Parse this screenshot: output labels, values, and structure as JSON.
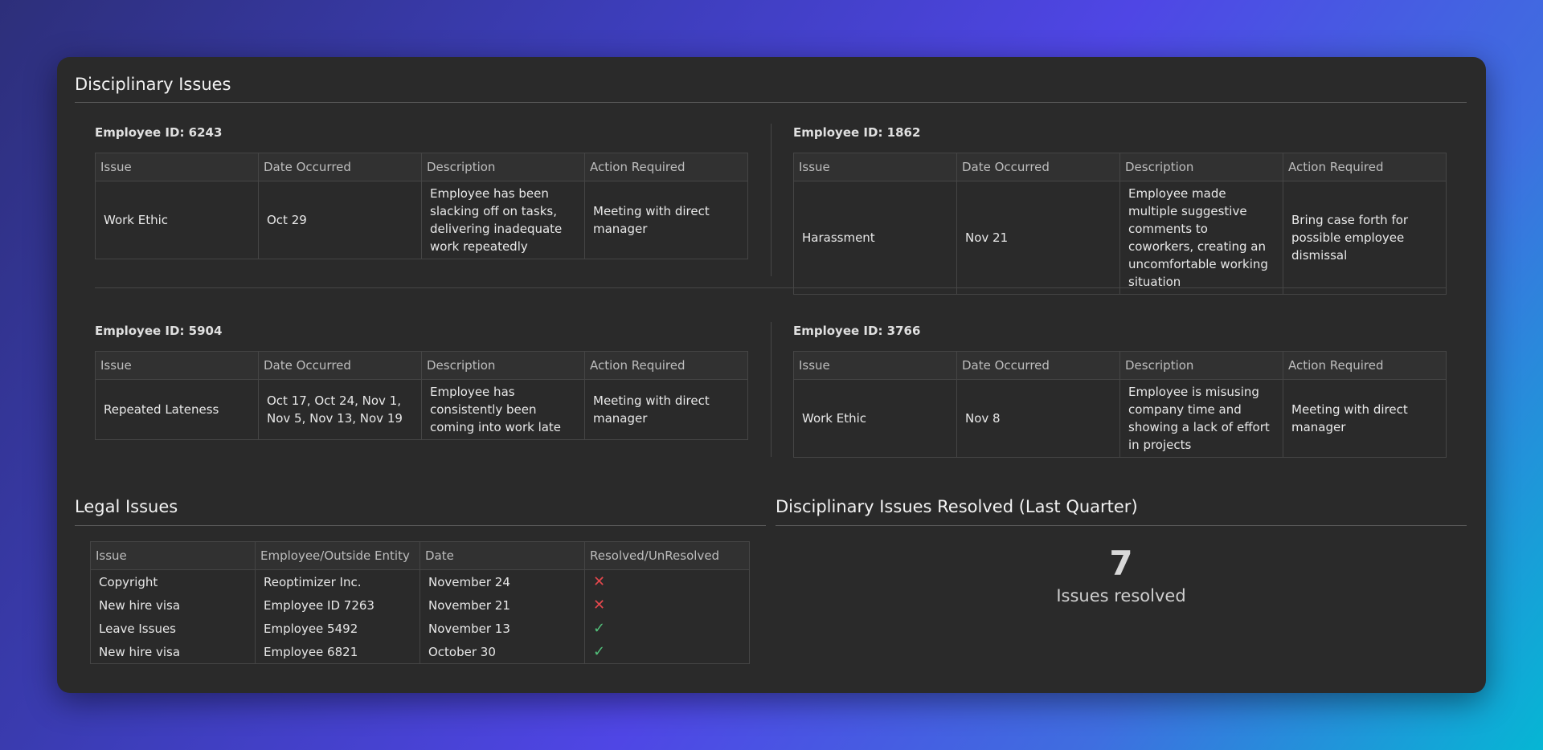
{
  "disciplinary": {
    "title": "Disciplinary Issues",
    "columns": [
      "Issue",
      "Date Occurred",
      "Description",
      "Action Required"
    ],
    "employees": [
      {
        "employee_id": "Employee ID: 6243",
        "issue": "Work Ethic",
        "date": "Oct 29",
        "description": "Employee has been slacking off on tasks, delivering inadequate work repeatedly",
        "action": "Meeting with direct manager"
      },
      {
        "employee_id": "Employee ID: 1862",
        "issue": "Harassment",
        "date": "Nov 21",
        "description": "Employee made multiple suggestive comments to coworkers, creating an uncomfortable working situation",
        "action": "Bring case forth for possible employee dismissal"
      },
      {
        "employee_id": "Employee ID: 5904",
        "issue": "Repeated Lateness",
        "date": "Oct 17, Oct 24, Nov 1, Nov 5, Nov 13, Nov 19",
        "description": "Employee has consistently been coming into work late",
        "action": "Meeting with direct manager"
      },
      {
        "employee_id": "Employee ID: 3766",
        "issue": "Work Ethic",
        "date": "Nov 8",
        "description": "Employee is misusing company time and showing a lack of effort in projects",
        "action": "Meeting with direct manager"
      }
    ]
  },
  "legal": {
    "title": "Legal Issues",
    "columns": [
      "Issue",
      "Employee/Outside Entity",
      "Date",
      "Resolved/UnResolved"
    ],
    "rows": [
      {
        "issue": "Copyright",
        "entity": "Reoptimizer Inc.",
        "date": "November 24",
        "status_icon": "x-icon",
        "status_color": "#e5484d"
      },
      {
        "issue": "New hire visa",
        "entity": "Employee ID 7263",
        "date": "November 21",
        "status_icon": "x-icon",
        "status_color": "#e5484d"
      },
      {
        "issue": "Leave Issues",
        "entity": "Employee 5492",
        "date": "November 13",
        "status_icon": "check-icon",
        "status_color": "#52c07a"
      },
      {
        "issue": "New hire visa",
        "entity": "Employee 6821",
        "date": "October 30",
        "status_icon": "check-icon",
        "status_color": "#52c07a"
      }
    ]
  },
  "resolved": {
    "title": "Disciplinary Issues Resolved (Last Quarter)",
    "value": "7",
    "label": "Issues resolved"
  }
}
